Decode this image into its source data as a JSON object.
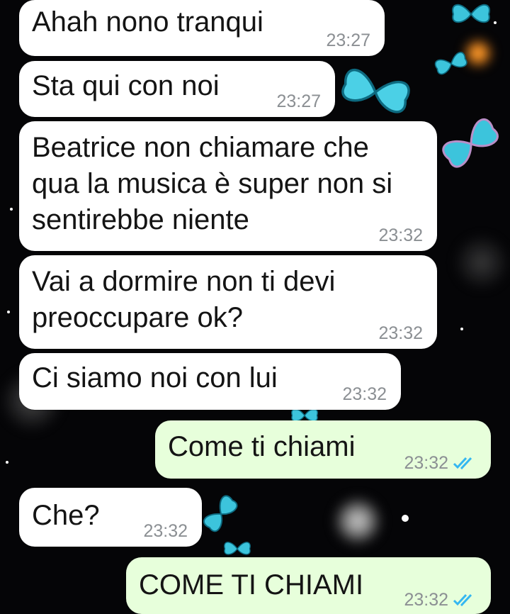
{
  "chat": {
    "messages": [
      {
        "direction": "in",
        "text": "Ahah nono tranqui",
        "time": "23:27"
      },
      {
        "direction": "in",
        "text": "Sta qui con noi",
        "time": "23:27"
      },
      {
        "direction": "in",
        "text": "Beatrice non chiamare che\nqua la musica è super non si\nsentirebbe niente",
        "time": "23:32"
      },
      {
        "direction": "in",
        "text": "Vai a dormire non ti devi\npreoccupare ok?",
        "time": "23:32"
      },
      {
        "direction": "in",
        "text": "Ci siamo noi con lui",
        "time": "23:32"
      },
      {
        "direction": "out",
        "text": "Come ti chiami",
        "time": "23:32",
        "status": "read"
      },
      {
        "direction": "in",
        "text": "Che?",
        "time": "23:32"
      },
      {
        "direction": "out",
        "text": "COME TI CHIAMI",
        "time": "23:32",
        "status": "read"
      }
    ]
  },
  "theme": {
    "incoming_bubble": "#ffffff",
    "outgoing_bubble": "#e7ffdb",
    "read_tick_color": "#34b7f1",
    "wallpaper": "black with cyan butterflies and bokeh lights"
  }
}
